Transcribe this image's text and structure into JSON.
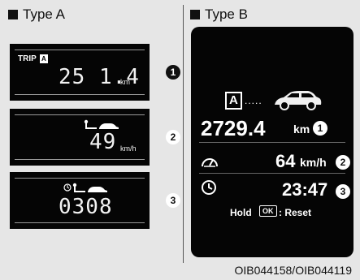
{
  "type_a": {
    "header": "Type A",
    "trip": {
      "label": "TRIP",
      "letter": "A",
      "value": "25 1.4",
      "unit": "km",
      "badge": "1"
    },
    "speed": {
      "value": "49",
      "unit": "km/h",
      "badge": "2"
    },
    "time": {
      "value": "0308",
      "badge": "3"
    }
  },
  "type_b": {
    "header": "Type B",
    "trip_letter": "A",
    "distance": {
      "value": "2729.4",
      "unit": "km",
      "badge": "1"
    },
    "speed": {
      "value": "64",
      "unit": "km/h",
      "badge": "2"
    },
    "time": {
      "value": "23:47",
      "badge": "3"
    },
    "hold": {
      "prefix": "Hold",
      "key": "OK",
      "suffix": ": Reset"
    }
  },
  "figure_code": "OIB044158/OIB044119",
  "icons": [
    "car-icon",
    "fuel-pump-icon",
    "clock-icon",
    "speedometer-icon"
  ]
}
